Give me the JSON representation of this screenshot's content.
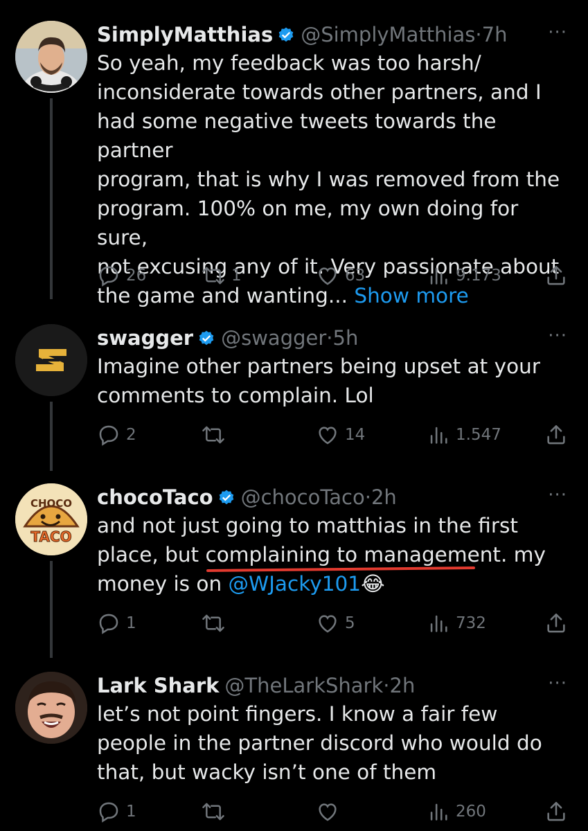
{
  "tweets": [
    {
      "name": "SimplyMatthias",
      "handle": "@SimplyMatthias",
      "separator": "·",
      "time": "7h",
      "text_lines": [
        "So yeah, my feedback was too harsh/",
        "inconsiderate towards other partners, and I",
        "had some negative tweets towards the partner",
        "program, that is why I was removed from the",
        "program. 100% on me, my own doing for sure,",
        "not excusing any of it. Very passionate about",
        "the game and wanting..."
      ],
      "show_more": "Show more",
      "replies": "26",
      "retweets": "1",
      "likes": "63",
      "views": "9.173"
    },
    {
      "name": "swagger",
      "handle": "@swagger",
      "separator": "·",
      "time": "5h",
      "text_lines": [
        "Imagine other partners being upset at your",
        "comments to complain. Lol"
      ],
      "replies": "2",
      "retweets": "",
      "likes": "14",
      "views": "1.547"
    },
    {
      "name": "chocoTaco",
      "handle": "@chocoTaco",
      "separator": "·",
      "time": "2h",
      "text_lines": [
        "and not just going to matthias in the first",
        "place, but complaining to management. my",
        "money is on"
      ],
      "mention": "@WJacky101",
      "emoji": "😂",
      "replies": "1",
      "retweets": "",
      "likes": "5",
      "views": "732",
      "avatar_text_top": "CHOCO",
      "avatar_text_bottom": "TACO"
    },
    {
      "name": "Lark Shark",
      "handle": "@TheLarkShark",
      "separator": "·",
      "time": "2h",
      "text_lines": [
        "let’s not point fingers. I know a fair few",
        "people in the partner discord who would do",
        "that, but wacky isn’t one of them"
      ],
      "replies": "1",
      "retweets": "",
      "likes": "",
      "views": "260"
    }
  ],
  "more_glyph": "···",
  "colors": {
    "background": "#000000",
    "text": "#e7e9ea",
    "secondary": "#71767b",
    "link": "#1d9bf0",
    "verified": "#1d9bf0",
    "annotation": "#e23a2f"
  }
}
